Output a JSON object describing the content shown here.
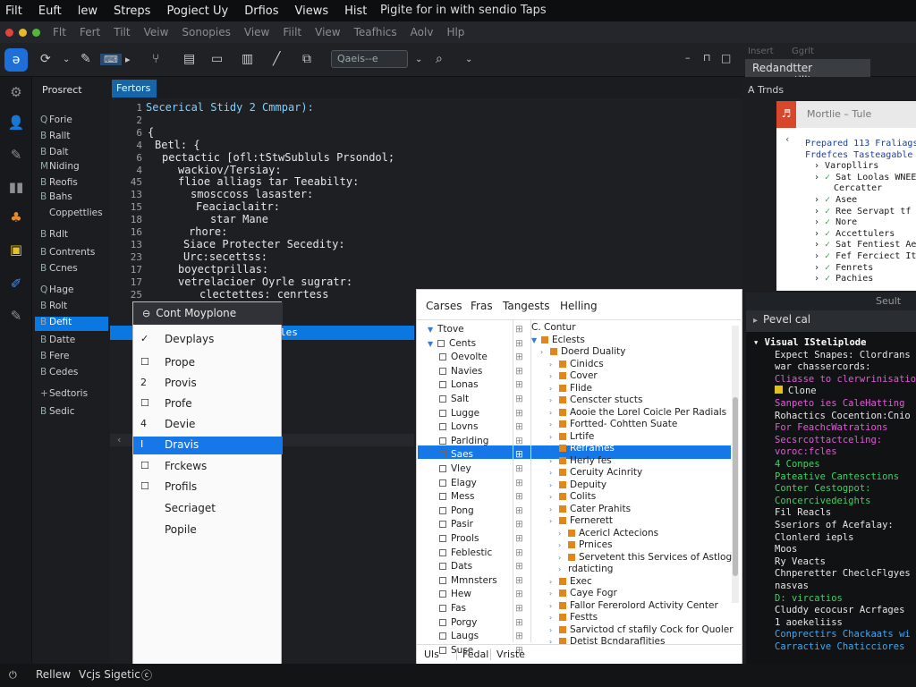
{
  "menubar": {
    "items": [
      "Filt",
      "Euft",
      "lew",
      "Streps",
      "Pogiect Uy",
      "Drfios",
      "Views",
      "Hist"
    ],
    "title": "Pigite for in with sendio Taps"
  },
  "menu2": {
    "items": [
      "Flt",
      "Fert",
      "Tilt",
      "Veiw",
      "Sonopies",
      "View",
      "Fiilt",
      "View",
      "Teafhics",
      "Aolv",
      "Hlp"
    ]
  },
  "toolbar": {
    "search_value": "Qaeis--e",
    "right_label": "Redandtter snomcotility",
    "right_tabs": [
      "Insert",
      "Ggrlt"
    ]
  },
  "sidebar": {
    "heading": "Prosrect",
    "items": [
      {
        "label": "Forie",
        "icon": "Q"
      },
      {
        "label": "Rallt",
        "icon": "B"
      },
      {
        "label": "Dalt",
        "icon": "B"
      },
      {
        "label": "Niding",
        "icon": "M"
      },
      {
        "label": "Reofis",
        "icon": "B"
      },
      {
        "label": "Bahs",
        "icon": "B"
      },
      {
        "label": "Coppettlies",
        "icon": ""
      },
      {
        "label": "Rdlt",
        "icon": "B"
      },
      {
        "label": "Contrents",
        "icon": "B"
      },
      {
        "label": "Ccnes",
        "icon": "B"
      },
      {
        "label": "Hage",
        "icon": "Q"
      },
      {
        "label": "Rolt",
        "icon": "B"
      },
      {
        "label": "Defit",
        "icon": "B",
        "selected": true
      },
      {
        "label": "Datte",
        "icon": "B"
      },
      {
        "label": "Fere",
        "icon": "B"
      },
      {
        "label": "Cedes",
        "icon": "B"
      },
      {
        "label": "Sedtoris",
        "icon": "+"
      },
      {
        "label": "Sedic",
        "icon": "B"
      }
    ]
  },
  "editor": {
    "tab_label": "Fertors",
    "lines": [
      {
        "n": "1",
        "text": "Secerical Stidy 2 Cmmpar):"
      },
      {
        "n": "2",
        "text": ""
      },
      {
        "n": "6",
        "text": "{"
      },
      {
        "n": "4",
        "text": "Betl: {"
      },
      {
        "n": "6",
        "text": "pectactic [ofl:tStwSubluls Prsondol;"
      },
      {
        "n": "4",
        "text": "wackiov/Tersiay:"
      },
      {
        "n": "45",
        "text": "flioe alliags tar Teeabilty:"
      },
      {
        "n": "13",
        "text": "smosccoss lasaster:"
      },
      {
        "n": "15",
        "text": "Feaciaclaitr:"
      },
      {
        "n": "18",
        "text": "star Mane"
      },
      {
        "n": "16",
        "text": "rhore:"
      },
      {
        "n": "13",
        "text": "Siace Protecter Secedity:"
      },
      {
        "n": "23",
        "text": "Urc:secettss:"
      },
      {
        "n": "17",
        "text": "boyectprillas:"
      },
      {
        "n": "17",
        "text": "vetrelacioer Oyrle sugratr:"
      },
      {
        "n": "25",
        "text": "clectettes: cenrtess"
      }
    ],
    "highlight_tail": "les"
  },
  "dropdown": {
    "header": "Cont Moyplone",
    "items": [
      {
        "label": "Devplays",
        "mark": "✓"
      },
      {
        "label": "Prope",
        "mark": "☐"
      },
      {
        "label": "Provis",
        "mark": "2"
      },
      {
        "label": "Profe",
        "mark": "☐"
      },
      {
        "label": "Devie",
        "mark": "4"
      },
      {
        "label": "Dravis",
        "mark": "I",
        "active": true
      },
      {
        "label": "Frckews",
        "mark": "☐"
      },
      {
        "label": "Profils",
        "mark": "☐"
      },
      {
        "label": "Secriaget",
        "mark": ""
      },
      {
        "label": "Popile",
        "mark": ""
      }
    ]
  },
  "tree": {
    "tabs": [
      "Carses",
      "Fras",
      "Tangests",
      "Helling"
    ],
    "left": [
      {
        "label": "Ttove",
        "kind": "exp"
      },
      {
        "label": "Cents",
        "kind": "exp2"
      },
      {
        "label": "Oevolte",
        "kind": "cb"
      },
      {
        "label": "Navies",
        "kind": "cb"
      },
      {
        "label": "Lonas",
        "kind": "cb"
      },
      {
        "label": "Salt",
        "kind": "cb"
      },
      {
        "label": "Lugge",
        "kind": "cb"
      },
      {
        "label": "Lovns",
        "kind": "cb"
      },
      {
        "label": "Parlding",
        "kind": "cb"
      },
      {
        "label": "Saes",
        "kind": "cb",
        "selected": true
      },
      {
        "label": "Vley",
        "kind": "cb"
      },
      {
        "label": "Elagy",
        "kind": "cb"
      },
      {
        "label": "Mess",
        "kind": "cb"
      },
      {
        "label": "Pong",
        "kind": "cb"
      },
      {
        "label": "Pasir",
        "kind": "cb"
      },
      {
        "label": "Prools",
        "kind": "cb"
      },
      {
        "label": "Feblestic",
        "kind": "cb"
      },
      {
        "label": "Dats",
        "kind": "cb"
      },
      {
        "label": "Mmnsters",
        "kind": "cb"
      },
      {
        "label": "Hew",
        "kind": "cb"
      },
      {
        "label": "Fas",
        "kind": "cb"
      },
      {
        "label": "Porgy",
        "kind": "cb"
      },
      {
        "label": "Laugs",
        "kind": "cb"
      },
      {
        "label": "Suse",
        "kind": "cb"
      }
    ],
    "right": [
      {
        "label": "C. Contur",
        "indent": 0,
        "kind": "plain"
      },
      {
        "label": "Eclests",
        "indent": 0,
        "kind": "file"
      },
      {
        "label": "Doerd Duality",
        "indent": 1,
        "kind": "file"
      },
      {
        "label": "Cinidcs",
        "indent": 2,
        "kind": "file"
      },
      {
        "label": "Cover",
        "indent": 2,
        "kind": "file"
      },
      {
        "label": "Flide",
        "indent": 2,
        "kind": "file"
      },
      {
        "label": "Censcter stucts",
        "indent": 2,
        "kind": "file"
      },
      {
        "label": "Aooie the Lorel Coicle Per Radials",
        "indent": 2,
        "kind": "file"
      },
      {
        "label": "Fortted- Cohtten Suate",
        "indent": 2,
        "kind": "file"
      },
      {
        "label": "Lrtife",
        "indent": 2,
        "kind": "file"
      },
      {
        "label": "Reframes",
        "indent": 2,
        "kind": "file",
        "selected": true
      },
      {
        "label": "Herly fes",
        "indent": 2,
        "kind": "file"
      },
      {
        "label": "Ceruity Acinrity",
        "indent": 2,
        "kind": "file"
      },
      {
        "label": "Depuity",
        "indent": 2,
        "kind": "file"
      },
      {
        "label": "Colits",
        "indent": 2,
        "kind": "file"
      },
      {
        "label": "Cater Prahits",
        "indent": 2,
        "kind": "file"
      },
      {
        "label": "Fernerett",
        "indent": 2,
        "kind": "file"
      },
      {
        "label": "Acericl Actecions",
        "indent": 3,
        "kind": "file"
      },
      {
        "label": "Prnices",
        "indent": 3,
        "kind": "file"
      },
      {
        "label": "Servetent this Services of Astloge",
        "indent": 3,
        "kind": "file"
      },
      {
        "label": "rdaticting",
        "indent": 3,
        "kind": "plain"
      },
      {
        "label": "Exec",
        "indent": 2,
        "kind": "file"
      },
      {
        "label": "Caye Fogr",
        "indent": 2,
        "kind": "file"
      },
      {
        "label": "Fallor Fererolord Activity Center",
        "indent": 2,
        "kind": "file"
      },
      {
        "label": "Festts",
        "indent": 2,
        "kind": "file"
      },
      {
        "label": "Sarvictod cf stafily Cock for Quoler",
        "indent": 2,
        "kind": "file"
      },
      {
        "label": "Detist Bcndaraflities",
        "indent": 2,
        "kind": "file"
      }
    ],
    "footer": [
      "Uls",
      "Fedal",
      "Vriste"
    ]
  },
  "right_panel": {
    "title": "A Trnds",
    "doc_header": "Mortlie – Tule",
    "doc_lines": [
      {
        "text": "Prepared 113 Fraliags",
        "kind": "blue"
      },
      {
        "text": "Frdefces Tasteagable",
        "kind": "blue"
      },
      {
        "text": "Varopllirs",
        "kind": "chev"
      },
      {
        "text": "Sat Loolas WNEE",
        "kind": "check"
      },
      {
        "text": "Cercatter",
        "kind": "plain"
      },
      {
        "text": "Asee",
        "kind": "check"
      },
      {
        "text": "Ree Servapt tf Lo",
        "kind": "check"
      },
      {
        "text": "Nore",
        "kind": "check"
      },
      {
        "text": "Accettulers",
        "kind": "check"
      },
      {
        "text": "Sat Fentiest Aerle",
        "kind": "check"
      },
      {
        "text": "Fef Ferciect Ity",
        "kind": "check"
      },
      {
        "text": "Fenrets",
        "kind": "check"
      },
      {
        "text": "Pachies",
        "kind": "check"
      }
    ],
    "terminal_header": "Seult",
    "terminal_tab": "Pevel cal",
    "terminal_lines": [
      {
        "text": "Visual ISteliplode",
        "color": "#ffffff",
        "bold": true
      },
      {
        "text": "Expect Snapes: Clordrans",
        "color": "#e6e6e6"
      },
      {
        "text": "war chassercords:",
        "color": "#e6e6e6"
      },
      {
        "text": "Cliasse to clerwrinisatio",
        "color": "#e05ad8"
      },
      {
        "text": "Clone",
        "color": "#e6e6e6",
        "swatch": true
      },
      {
        "text": "Sanpeto ies CaleHatting",
        "color": "#e05ad8"
      },
      {
        "text": "Rohactics Cocention:Cnio",
        "color": "#e6e6e6"
      },
      {
        "text": "For FeachcWatrations",
        "color": "#e05ad8"
      },
      {
        "text": "Secsrcottactceling:",
        "color": "#e05ad8"
      },
      {
        "text": "voroc:fcles",
        "color": "#e05ad8"
      },
      {
        "text": "4  Conpes",
        "color": "#3fd063"
      },
      {
        "text": "Pateative Cantesctions",
        "color": "#3fd063"
      },
      {
        "text": "Conter Cestogpot:",
        "color": "#3fd063"
      },
      {
        "text": "Concercivedeights",
        "color": "#3fd063"
      },
      {
        "text": "Fil Reacls",
        "color": "#e6e6e6"
      },
      {
        "text": "Sseriors of Acefalay:",
        "color": "#e6e6e6"
      },
      {
        "text": "Clonlerd iepls",
        "color": "#e6e6e6"
      },
      {
        "text": "Moos",
        "color": "#e6e6e6"
      },
      {
        "text": "Ry Veacts",
        "color": "#e6e6e6"
      },
      {
        "text": "Chnperetter CheclcFlgyes",
        "color": "#e6e6e6"
      },
      {
        "text": "nasvas",
        "color": "#e6e6e6"
      },
      {
        "text": "D: vircatios",
        "color": "#3fd063"
      },
      {
        "text": "Cluddy ecocusr Acrfages",
        "color": "#e6e6e6"
      },
      {
        "text": "1 aoekeliiss",
        "color": "#e6e6e6"
      },
      {
        "text": "Conprectirs Chackaats wi",
        "color": "#41a7f0"
      },
      {
        "text": "Carractive Chaticciores",
        "color": "#41a7f0"
      }
    ]
  },
  "status": {
    "left": "Rellew",
    "middle": "Vcjs Sigetic"
  },
  "colors": {
    "accent": "#0b77e0",
    "terminal_green": "#3fd063",
    "terminal_magenta": "#e05ad8"
  }
}
